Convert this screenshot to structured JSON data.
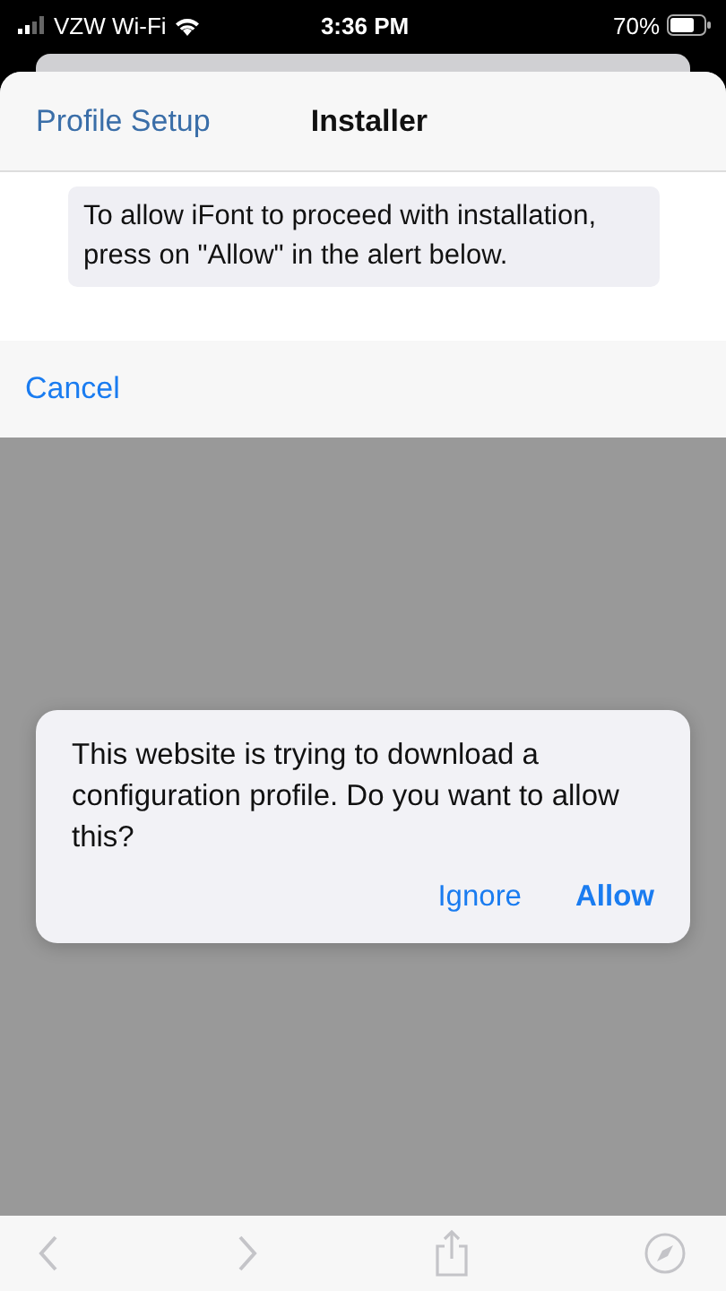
{
  "status_bar": {
    "carrier": "VZW Wi-Fi",
    "time": "3:36 PM",
    "battery": "70%"
  },
  "nav_bar": {
    "back": "Profile Setup",
    "title": "Installer"
  },
  "notice": "To allow iFont to proceed with installation, press on \"Allow\" in the alert below.",
  "cancel": "Cancel",
  "alert": {
    "message": "This website is trying to download a configuration profile. Do you want to allow this?",
    "buttons": [
      {
        "label": "Ignore",
        "kind": "normal"
      },
      {
        "label": "Allow",
        "kind": "preferred"
      }
    ]
  }
}
